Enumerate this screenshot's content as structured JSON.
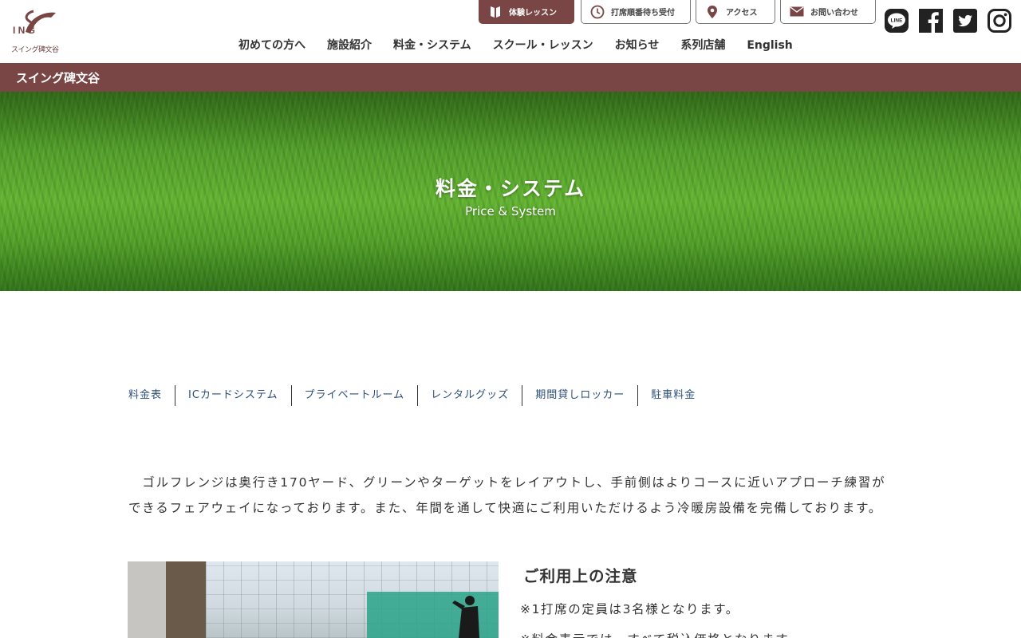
{
  "brand": {
    "logo_letters": "I N G",
    "logo_caption": "スイング碑文谷",
    "color": "#7a4545"
  },
  "top_buttons": [
    {
      "label": "体験レッスン",
      "icon": "book-icon"
    },
    {
      "label": "打席順番待ち受付",
      "icon": "clock-icon"
    },
    {
      "label": "アクセス",
      "icon": "map-pin-icon"
    },
    {
      "label": "お問い合わせ",
      "icon": "mail-icon"
    }
  ],
  "social": {
    "line_text": "LINE",
    "items": [
      "line-icon",
      "facebook-icon",
      "twitter-icon",
      "instagram-icon"
    ]
  },
  "nav": {
    "items": [
      "初めての方へ",
      "施設紹介",
      "料金・システム",
      "スクール・レッスン",
      "お知らせ",
      "系列店舗",
      "English"
    ]
  },
  "storebar": {
    "label": "スイング碑文谷"
  },
  "hero": {
    "title": "料金・システム",
    "subtitle": "Price & System"
  },
  "anchors": [
    "料金表",
    "ICカードシステム",
    "プライベートルーム",
    "レンタルグッズ",
    "期間貸しロッカー",
    "駐車料金"
  ],
  "intro": {
    "text": "　ゴルフレンジは奥行き170ヤード、グリーンやターゲットをレイアウトし、手前側はよりコースに近いアプローチ練習ができるフェアウェイになっております。また、年間を通して快適にご利用いただけるよう冷暖房設備を完備しております。"
  },
  "notes": {
    "title": "ご利用上の注意",
    "items": [
      "※1打席の定員は3名様となります。",
      "※料金表示では、すべて税込価格となります。"
    ]
  }
}
